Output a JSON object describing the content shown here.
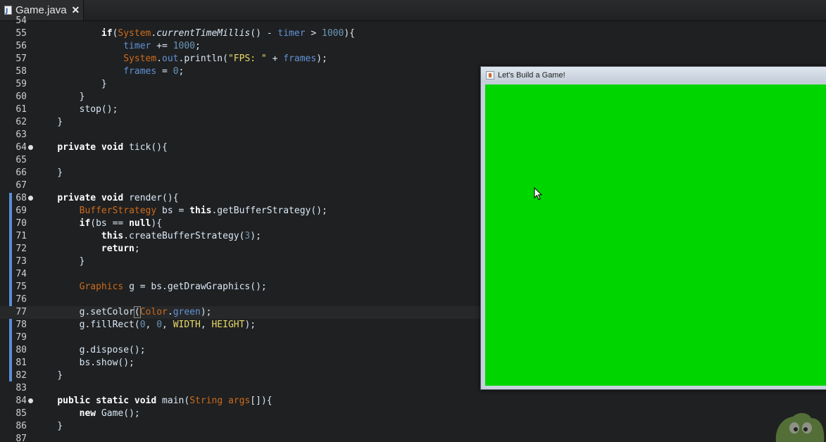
{
  "tab": {
    "label": "Game.java",
    "close": "✕",
    "file_icon": "java-file-icon"
  },
  "colors": {
    "editor_background": "#1f2021",
    "keyword": "#ffffff",
    "class_name": "#cc6c1d",
    "field": "#6192d8",
    "string": "#e6d96b",
    "number": "#6896ba",
    "change_bar": "#5b8ed6",
    "game_canvas": "#00d500"
  },
  "editor": {
    "lines": [
      {
        "num": "54",
        "fold": false,
        "tokens": []
      },
      {
        "num": "55",
        "fold": false,
        "tokens": [
          {
            "t": "            ",
            "c": "pl"
          },
          {
            "t": "if",
            "c": "kw"
          },
          {
            "t": "(",
            "c": "pl"
          },
          {
            "t": "System",
            "c": "cls"
          },
          {
            "t": ".",
            "c": "pl"
          },
          {
            "t": "currentTimeMillis",
            "c": "it"
          },
          {
            "t": "() - ",
            "c": "pl"
          },
          {
            "t": "timer",
            "c": "fld"
          },
          {
            "t": " > ",
            "c": "pl"
          },
          {
            "t": "1000",
            "c": "num"
          },
          {
            "t": "){",
            "c": "pl"
          }
        ]
      },
      {
        "num": "56",
        "fold": false,
        "tokens": [
          {
            "t": "                ",
            "c": "pl"
          },
          {
            "t": "timer",
            "c": "fld"
          },
          {
            "t": " += ",
            "c": "pl"
          },
          {
            "t": "1000",
            "c": "num"
          },
          {
            "t": ";",
            "c": "pl"
          }
        ]
      },
      {
        "num": "57",
        "fold": false,
        "tokens": [
          {
            "t": "                ",
            "c": "pl"
          },
          {
            "t": "System",
            "c": "cls"
          },
          {
            "t": ".",
            "c": "pl"
          },
          {
            "t": "out",
            "c": "fld"
          },
          {
            "t": ".println(",
            "c": "pl"
          },
          {
            "t": "\"FPS: \"",
            "c": "str"
          },
          {
            "t": " + ",
            "c": "pl"
          },
          {
            "t": "frames",
            "c": "fld"
          },
          {
            "t": ");",
            "c": "pl"
          }
        ]
      },
      {
        "num": "58",
        "fold": false,
        "tokens": [
          {
            "t": "                ",
            "c": "pl"
          },
          {
            "t": "frames",
            "c": "fld"
          },
          {
            "t": " = ",
            "c": "pl"
          },
          {
            "t": "0",
            "c": "num"
          },
          {
            "t": ";",
            "c": "pl"
          }
        ]
      },
      {
        "num": "59",
        "fold": false,
        "tokens": [
          {
            "t": "            }",
            "c": "pl"
          }
        ]
      },
      {
        "num": "60",
        "fold": false,
        "tokens": [
          {
            "t": "        }",
            "c": "pl"
          }
        ]
      },
      {
        "num": "61",
        "fold": false,
        "tokens": [
          {
            "t": "        stop();",
            "c": "pl"
          }
        ]
      },
      {
        "num": "62",
        "fold": false,
        "tokens": [
          {
            "t": "    }",
            "c": "pl"
          }
        ]
      },
      {
        "num": "63",
        "fold": false,
        "tokens": []
      },
      {
        "num": "64",
        "fold": true,
        "tokens": [
          {
            "t": "    ",
            "c": "pl"
          },
          {
            "t": "private",
            "c": "kw"
          },
          {
            "t": " ",
            "c": "pl"
          },
          {
            "t": "void",
            "c": "kw"
          },
          {
            "t": " tick(){",
            "c": "pl"
          }
        ]
      },
      {
        "num": "65",
        "fold": false,
        "tokens": []
      },
      {
        "num": "66",
        "fold": false,
        "tokens": [
          {
            "t": "    }",
            "c": "pl"
          }
        ]
      },
      {
        "num": "67",
        "fold": false,
        "tokens": []
      },
      {
        "num": "68",
        "fold": true,
        "tokens": [
          {
            "t": "    ",
            "c": "pl"
          },
          {
            "t": "private",
            "c": "kw"
          },
          {
            "t": " ",
            "c": "pl"
          },
          {
            "t": "void",
            "c": "kw"
          },
          {
            "t": " render(){",
            "c": "pl"
          }
        ]
      },
      {
        "num": "69",
        "fold": false,
        "tokens": [
          {
            "t": "        ",
            "c": "pl"
          },
          {
            "t": "BufferStrategy",
            "c": "cls"
          },
          {
            "t": " bs = ",
            "c": "pl"
          },
          {
            "t": "this",
            "c": "kw"
          },
          {
            "t": ".getBufferStrategy();",
            "c": "pl"
          }
        ]
      },
      {
        "num": "70",
        "fold": false,
        "tokens": [
          {
            "t": "        ",
            "c": "pl"
          },
          {
            "t": "if",
            "c": "kw"
          },
          {
            "t": "(bs == ",
            "c": "pl"
          },
          {
            "t": "null",
            "c": "kw"
          },
          {
            "t": "){",
            "c": "pl"
          }
        ]
      },
      {
        "num": "71",
        "fold": false,
        "tokens": [
          {
            "t": "            ",
            "c": "pl"
          },
          {
            "t": "this",
            "c": "kw"
          },
          {
            "t": ".createBufferStrategy(",
            "c": "pl"
          },
          {
            "t": "3",
            "c": "num"
          },
          {
            "t": ");",
            "c": "pl"
          }
        ]
      },
      {
        "num": "72",
        "fold": false,
        "tokens": [
          {
            "t": "            ",
            "c": "pl"
          },
          {
            "t": "return",
            "c": "kw"
          },
          {
            "t": ";",
            "c": "pl"
          }
        ]
      },
      {
        "num": "73",
        "fold": false,
        "tokens": [
          {
            "t": "        }",
            "c": "pl"
          }
        ]
      },
      {
        "num": "74",
        "fold": false,
        "tokens": []
      },
      {
        "num": "75",
        "fold": false,
        "tokens": [
          {
            "t": "        ",
            "c": "pl"
          },
          {
            "t": "Graphics",
            "c": "cls"
          },
          {
            "t": " g = bs.getDrawGraphics();",
            "c": "pl"
          }
        ]
      },
      {
        "num": "76",
        "fold": false,
        "tokens": []
      },
      {
        "num": "77",
        "fold": false,
        "tokens": [
          {
            "t": "        g.setColor",
            "c": "pl"
          },
          {
            "t": "(",
            "c": "brk"
          },
          {
            "t": "Color",
            "c": "cls"
          },
          {
            "t": ".",
            "c": "pl"
          },
          {
            "t": "green",
            "c": "fld"
          },
          {
            "t": ");",
            "c": "pl"
          }
        ]
      },
      {
        "num": "78",
        "fold": false,
        "tokens": [
          {
            "t": "        g.fillRect(",
            "c": "pl"
          },
          {
            "t": "0",
            "c": "num"
          },
          {
            "t": ", ",
            "c": "pl"
          },
          {
            "t": "0",
            "c": "num"
          },
          {
            "t": ", ",
            "c": "pl"
          },
          {
            "t": "WIDTH",
            "c": "str"
          },
          {
            "t": ", ",
            "c": "pl"
          },
          {
            "t": "HEIGHT",
            "c": "str"
          },
          {
            "t": ");",
            "c": "pl"
          }
        ]
      },
      {
        "num": "79",
        "fold": false,
        "tokens": []
      },
      {
        "num": "80",
        "fold": false,
        "tokens": [
          {
            "t": "        g.dispose();",
            "c": "pl"
          }
        ]
      },
      {
        "num": "81",
        "fold": false,
        "tokens": [
          {
            "t": "        bs.show();",
            "c": "pl"
          }
        ]
      },
      {
        "num": "82",
        "fold": false,
        "tokens": [
          {
            "t": "    }",
            "c": "pl"
          }
        ]
      },
      {
        "num": "83",
        "fold": false,
        "tokens": []
      },
      {
        "num": "84",
        "fold": true,
        "tokens": [
          {
            "t": "    ",
            "c": "pl"
          },
          {
            "t": "public",
            "c": "kw"
          },
          {
            "t": " ",
            "c": "pl"
          },
          {
            "t": "static",
            "c": "kw"
          },
          {
            "t": " ",
            "c": "pl"
          },
          {
            "t": "void",
            "c": "kw"
          },
          {
            "t": " main(",
            "c": "pl"
          },
          {
            "t": "String",
            "c": "cls"
          },
          {
            "t": " ",
            "c": "pl"
          },
          {
            "t": "args",
            "c": "cls"
          },
          {
            "t": "[]){",
            "c": "pl"
          }
        ]
      },
      {
        "num": "85",
        "fold": false,
        "tokens": [
          {
            "t": "        ",
            "c": "pl"
          },
          {
            "t": "new",
            "c": "kw"
          },
          {
            "t": " Game();",
            "c": "pl"
          }
        ]
      },
      {
        "num": "86",
        "fold": false,
        "tokens": [
          {
            "t": "    }",
            "c": "pl"
          }
        ]
      },
      {
        "num": "87",
        "fold": false,
        "tokens": []
      }
    ],
    "current_line": "77",
    "changed_lines": [
      "68",
      "69",
      "70",
      "71",
      "72",
      "73",
      "74",
      "75",
      "76",
      "77",
      "78",
      "79",
      "80",
      "81",
      "82"
    ]
  },
  "game_window": {
    "title": "Let's Build a Game!",
    "icon": "java-app-icon"
  }
}
